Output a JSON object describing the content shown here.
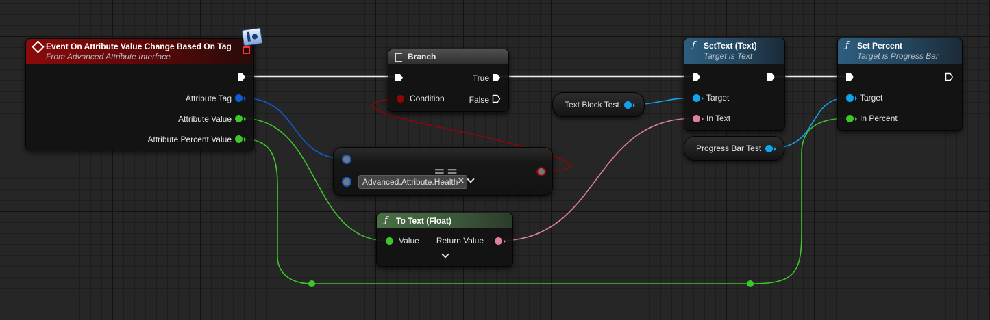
{
  "nodes": {
    "event": {
      "title": "Event On Attribute Value Change Based On Tag",
      "subtitle": "From Advanced Attribute Interface",
      "pins": {
        "attribute_tag": "Attribute Tag",
        "attribute_value": "Attribute Value",
        "attribute_percent_value": "Attribute Percent Value"
      }
    },
    "branch": {
      "title": "Branch",
      "pins": {
        "condition": "Condition",
        "true": "True",
        "false": "False"
      }
    },
    "equals": {
      "symbol": "==",
      "tag_value": "Advanced.Attribute.Health"
    },
    "to_text": {
      "title": "To Text (Float)",
      "pins": {
        "value": "Value",
        "return_value": "Return Value"
      }
    },
    "set_text": {
      "title": "SetText (Text)",
      "subtitle": "Target is Text",
      "pins": {
        "target": "Target",
        "in_text": "In Text"
      }
    },
    "set_percent": {
      "title": "Set Percent",
      "subtitle": "Target is Progress Bar",
      "pins": {
        "target": "Target",
        "in_percent": "In Percent"
      }
    },
    "text_block_var": {
      "label": "Text Block Test"
    },
    "progress_bar_var": {
      "label": "Progress Bar Test"
    }
  },
  "colors": {
    "exec": "#ffffff",
    "gameplay_tag": "#0e5bd6",
    "float": "#3ec72a",
    "object_ref": "#10a4ee",
    "text": "#e27ea4",
    "boolean": "#8f0606",
    "event_header": "#8c0a0a",
    "function_header": "#2e5d80",
    "pure_header": "#4a6e47"
  }
}
